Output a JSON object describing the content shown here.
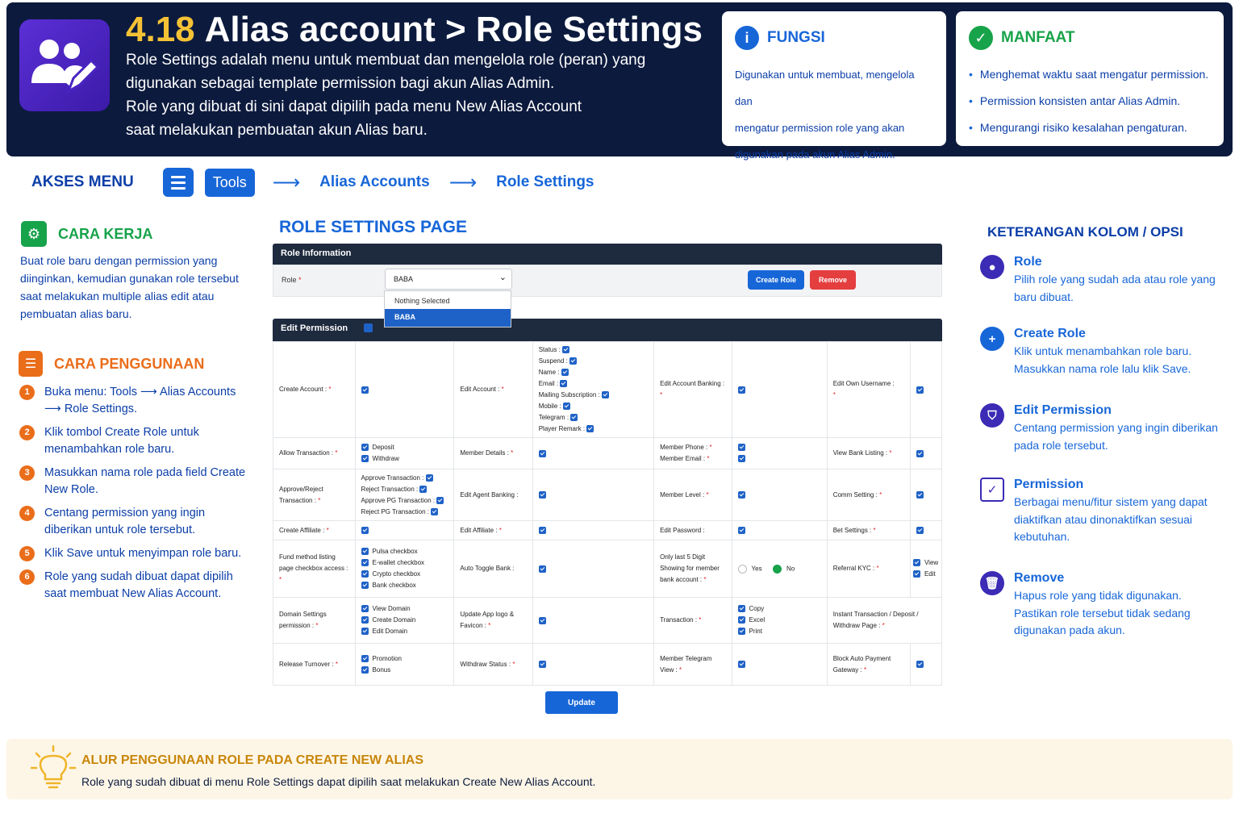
{
  "header": {
    "number": "4.18",
    "title": "Alias account > Role Settings",
    "desc_lines": [
      "Role Settings adalah menu untuk membuat dan mengelola role (peran) yang",
      "digunakan sebagai template permission bagi akun Alias Admin.",
      "Role yang dibuat di sini dapat dipilih pada menu New Alias Account",
      "saat melakukan pembuatan akun Alias baru."
    ],
    "fungsi": {
      "title": "FUNGSI",
      "lines": [
        "Digunakan untuk membuat, mengelola dan",
        "mengatur permission role yang akan",
        "digunakan pada akun Alias Admin."
      ]
    },
    "manfaat": {
      "title": "MANFAAT",
      "items": [
        "Menghemat waktu saat mengatur permission.",
        "Permission konsisten antar Alias Admin.",
        "Mengurangi risiko kesalahan pengaturan."
      ]
    }
  },
  "akses": {
    "label": "AKSES MENU",
    "tools": "Tools",
    "crumbs": [
      "Alias Accounts",
      "Role Settings"
    ]
  },
  "cara_kerja": {
    "title": "CARA KERJA",
    "text": "Buat role baru dengan permission yang diinginkan, kemudian gunakan role tersebut saat melakukan multiple alias edit atau pembuatan alias baru."
  },
  "cara_penggunaan": {
    "title": "CARA PENGGUNAAN",
    "steps": [
      "Buka menu: Tools ⟶ Alias Accounts ⟶ Role Settings.",
      "Klik tombol Create Role untuk menambahkan role baru.",
      "Masukkan nama role pada field Create New Role.",
      "Centang permission yang ingin diberikan untuk role tersebut.",
      "Klik Save untuk menyimpan role baru.",
      "Role yang sudah dibuat dapat dipilih saat membuat New Alias Account."
    ]
  },
  "screen": {
    "page_title": "ROLE SETTINGS PAGE",
    "role_info": "Role Information",
    "role_label": "Role",
    "role_value": "BABA",
    "dropdown": [
      "Nothing Selected",
      "BABA"
    ],
    "create_role": "Create Role",
    "remove": "Remove",
    "edit_permission": "Edit Permission",
    "update": "Update",
    "cells": {
      "create_account": "Create Account :",
      "edit_account": "Edit Account :",
      "acct_fields": [
        "Status :",
        "Suspend :",
        "Name :",
        "Email :",
        "Mailing Subscription :",
        "Mobile :",
        "Telegram :",
        "Player Remark :"
      ],
      "edit_account_banking": "Edit Account Banking :",
      "edit_own_username": "Edit Own Username :",
      "allow_transaction": "Allow Transaction :",
      "allow_opts": [
        "Deposit",
        "Withdraw"
      ],
      "member_details": "Member Details :",
      "member_phone": "Member Phone :",
      "member_email": "Member Email :",
      "view_bank_listing": "View Bank Listing :",
      "approve_reject": "Approve/Reject Transaction :",
      "approve_opts": [
        "Approve Transaction :",
        "Reject Transaction :",
        "Approve PG Transaction :",
        "Reject PG Transaction :"
      ],
      "edit_agent_banking": "Edit Agent Banking :",
      "member_level": "Member Level :",
      "comm_setting": "Comm Setting :",
      "create_affiliate": "Create Affiliate :",
      "edit_affiliate": "Edit Affiliate :",
      "edit_password": "Edit Password :",
      "bet_settings": "Bet Settings :",
      "fund_method": "Fund method listing page checkbox access :",
      "fund_opts": [
        "Pulsa checkbox",
        "E-wallet checkbox",
        "Crypto checkbox",
        "Bank checkbox"
      ],
      "auto_toggle_bank": "Auto Toggle Bank :",
      "only_last5": "Only last 5 Digit Showing for member bank account :",
      "yes": "Yes",
      "no": "No",
      "referral_kyc": "Referral KYC :",
      "kyc_opts": [
        "View",
        "Edit"
      ],
      "domain_settings": "Domain Settings permission :",
      "domain_opts": [
        "View Domain",
        "Create Domain",
        "Edit Domain"
      ],
      "update_app_logo": "Update App logo & Favicon :",
      "transaction": "Transaction :",
      "trans_opts": [
        "Copy",
        "Excel",
        "Print"
      ],
      "instant_transaction": "Instant Transaction / Deposit / Withdraw Page :",
      "release_turnover": "Release Turnover :",
      "turnover_opts": [
        "Promotion",
        "Bonus"
      ],
      "withdraw_status": "Withdraw Status :",
      "member_telegram": "Member Telegram View :",
      "block_auto_payment": "Block Auto Payment Gateway :"
    }
  },
  "keterangan": {
    "title": "KETERANGAN KOLOM / OPSI",
    "items": [
      {
        "title": "Role",
        "desc": "Pilih role yang sudah ada atau role yang baru dibuat."
      },
      {
        "title": "Create Role",
        "desc": "Klik untuk menambahkan role baru. Masukkan nama role lalu klik Save."
      },
      {
        "title": "Edit Permission",
        "desc": "Centang permission yang ingin diberikan pada role tersebut."
      },
      {
        "title": "Permission",
        "desc": "Berbagai menu/fitur sistem yang dapat diaktifkan atau dinonaktifkan sesuai kebutuhan."
      },
      {
        "title": "Remove",
        "desc": "Hapus role yang tidak digunakan. Pastikan role tersebut tidak sedang digunakan pada akun."
      }
    ]
  },
  "banner": {
    "title": "ALUR PENGGUNAAN ROLE PADA CREATE NEW ALIAS",
    "text": "Role yang sudah dibuat di menu Role Settings dapat dipilih saat melakukan Create New Alias Account."
  }
}
